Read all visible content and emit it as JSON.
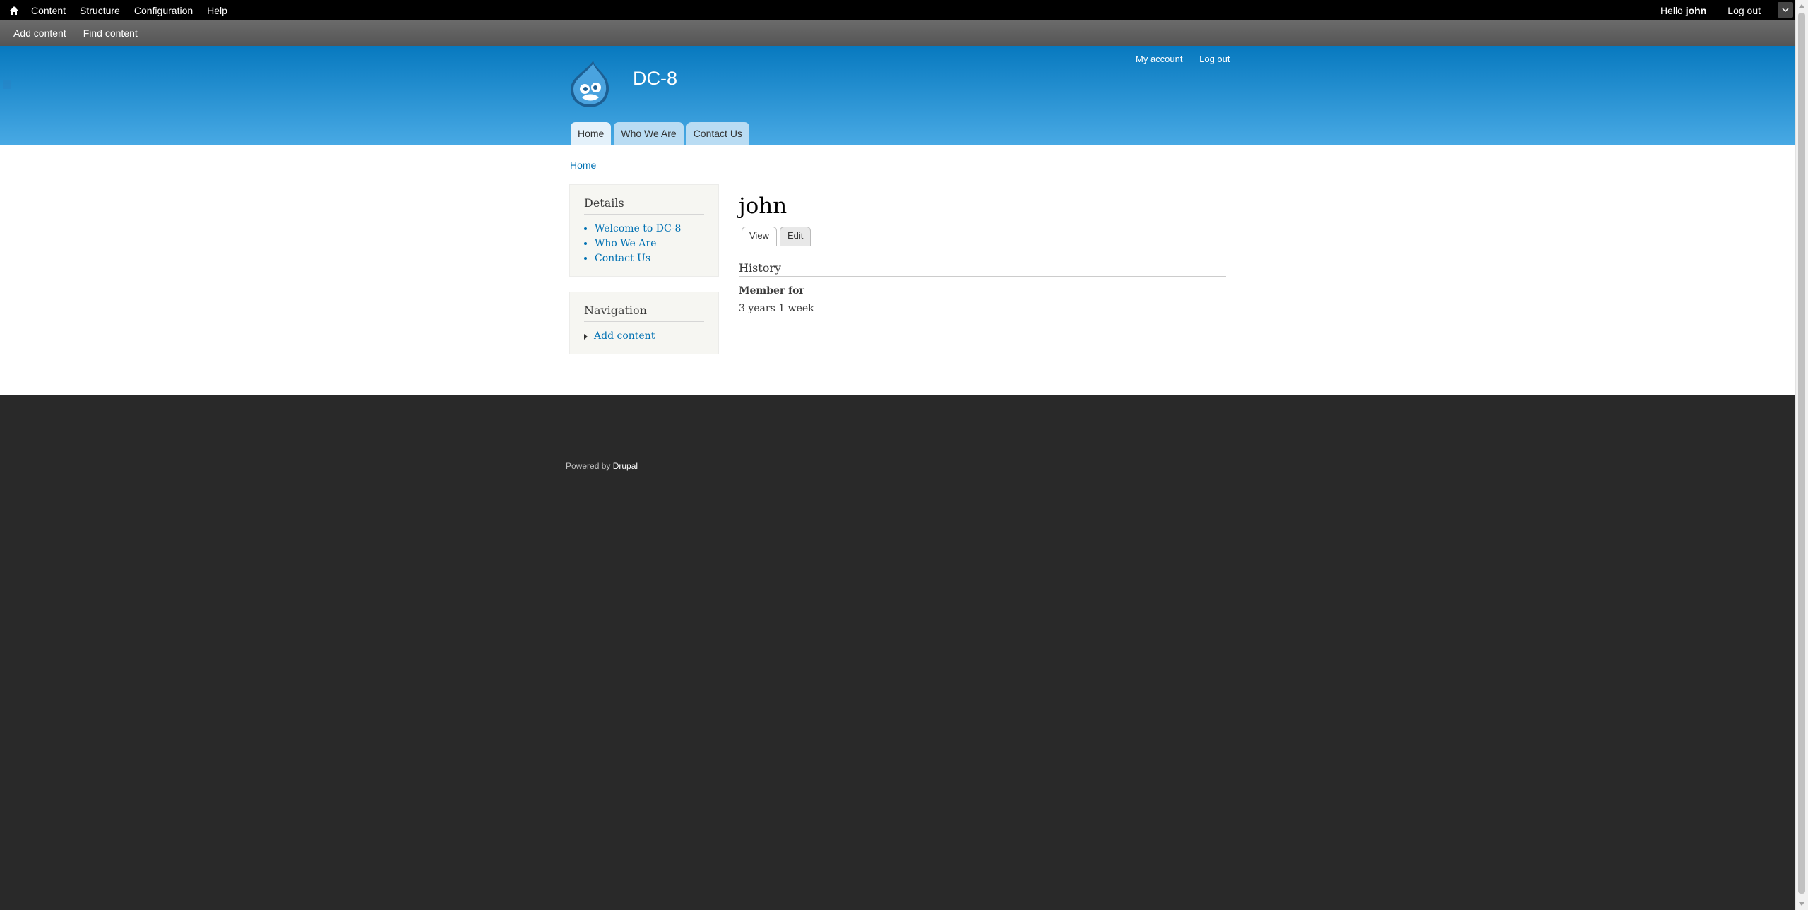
{
  "toolbar": {
    "menu": [
      "Content",
      "Structure",
      "Configuration",
      "Help"
    ],
    "greeting": "Hello",
    "username": "john",
    "logout": "Log out"
  },
  "shortcuts": [
    "Add content",
    "Find content"
  ],
  "header": {
    "site_name": "DC-8",
    "secondary_menu": [
      "My account",
      "Log out"
    ],
    "main_menu": [
      "Home",
      "Who We Are",
      "Contact Us"
    ]
  },
  "breadcrumb": "Home",
  "sidebar": {
    "details": {
      "title": "Details",
      "links": [
        "Welcome to DC-8",
        "Who We Are",
        "Contact Us"
      ]
    },
    "navigation": {
      "title": "Navigation",
      "links": [
        "Add content"
      ]
    }
  },
  "main": {
    "title": "john",
    "tabs": [
      "View",
      "Edit"
    ],
    "history_title": "History",
    "member_label": "Member for",
    "member_value": "3 years 1 week"
  },
  "footer": {
    "powered_by": "Powered by",
    "drupal": "Drupal"
  },
  "colors": {
    "header_top": "#0779bf",
    "header_bottom": "#48a9e4",
    "link": "#0071b3",
    "footer_bg": "#292929"
  }
}
